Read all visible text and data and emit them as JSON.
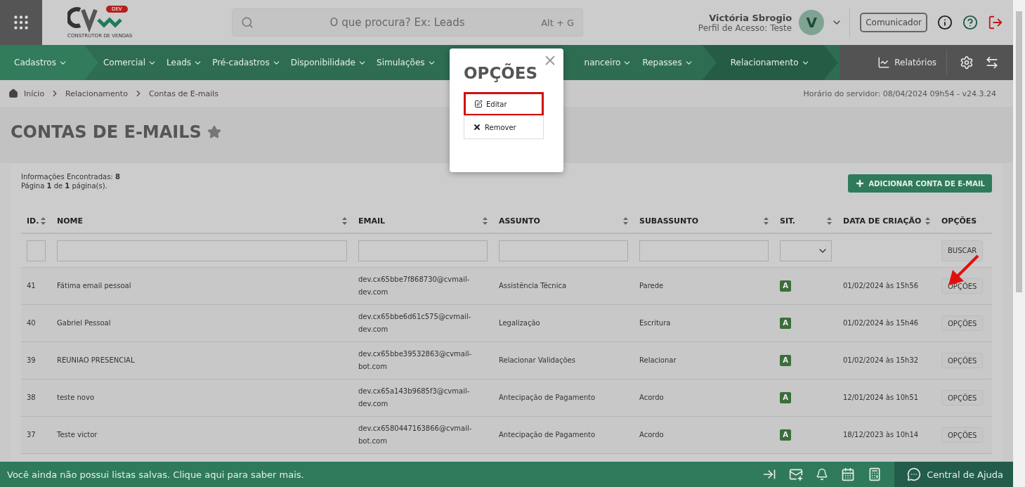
{
  "header": {
    "search": {
      "placeholder": "O que procura? Ex: Leads",
      "shortcut": "Alt + G"
    },
    "logo": {
      "badge": "DEV",
      "tagline": "CONSTRUTOR DE VENDAS"
    },
    "user": {
      "name": "Victória Sbrogio",
      "profile": "Perfil de Acesso: Teste",
      "initial": "V"
    },
    "communicator_button": "Comunicador"
  },
  "nav": {
    "items": [
      {
        "label": "Cadastros",
        "kind": "start"
      },
      {
        "label": "Comercial",
        "kind": "normal"
      },
      {
        "label": "Leads",
        "kind": "normal"
      },
      {
        "label": "Pré-cadastros",
        "kind": "normal"
      },
      {
        "label": "Disponibilidade",
        "kind": "normal"
      },
      {
        "label": "Simulações",
        "kind": "normal"
      },
      {
        "label": "nanceiro",
        "kind": "cut"
      },
      {
        "label": "Repasses",
        "kind": "normal"
      },
      {
        "label": "Relacionamento",
        "kind": "current"
      }
    ],
    "reports": "Relatórios"
  },
  "breadcrumb": [
    "Início",
    "Relacionamento",
    "Contas de E-mails"
  ],
  "server_time": "Horário do servidor: 08/04/2024 09h54 - v24.3.24",
  "page_title": "CONTAS DE E-MAILS",
  "summary": [
    "Informações Encontradas: **8**",
    "Página **1** de **1** página(s)."
  ],
  "add_button": "ADICIONAR CONTA DE E-MAIL",
  "table": {
    "columns": [
      {
        "label": "ID.",
        "sortable": true,
        "kind": "text"
      },
      {
        "label": "NOME",
        "sortable": true,
        "kind": "text"
      },
      {
        "label": "EMAIL",
        "sortable": true,
        "kind": "text"
      },
      {
        "label": "ASSUNTO",
        "sortable": true,
        "kind": "text"
      },
      {
        "label": "SUBASSUNTO",
        "sortable": true,
        "kind": "text"
      },
      {
        "label": "SIT.",
        "sortable": true,
        "kind": "select"
      },
      {
        "label": "DATA DE CRIAÇÃO",
        "sortable": true,
        "kind": "none"
      },
      {
        "label": "OPÇÕES",
        "sortable": false,
        "kind": "button"
      }
    ],
    "search_button": "BUSCAR",
    "rows": [
      {
        "id": "41",
        "name": "Fátima email pessoal",
        "email": "dev.cx65bbe7f868730@cvmail-dev.com",
        "subject": "Assistência Técnica",
        "subsubject": "Parede",
        "status": "A",
        "created": "01/02/2024 às 15h56",
        "options": "OPÇÕES"
      },
      {
        "id": "40",
        "name": "Gabriel Pessoal",
        "email": "dev.cx65bbe6d61c575@cvmail-dev.com",
        "subject": "Legalização",
        "subsubject": "Escritura",
        "status": "A",
        "created": "01/02/2024 às 15h46",
        "options": "OPÇÕES"
      },
      {
        "id": "39",
        "name": "REUNIAO PRESENCIAL",
        "email": "dev.cx65bbe39532863@cvmail-bot.com",
        "subject": "Relacionar Validações",
        "subsubject": "Relacionar",
        "status": "A",
        "created": "01/02/2024 às 15h32",
        "options": "OPÇÕES"
      },
      {
        "id": "38",
        "name": "teste novo",
        "email": "dev.cx65a143b9685f3@cvmail-dev.com",
        "subject": "Antecipação de Pagamento",
        "subsubject": "Acordo",
        "status": "A",
        "created": "12/01/2024 às 10h51",
        "options": "OPÇÕES"
      },
      {
        "id": "37",
        "name": "Teste victor",
        "email": "dev.cx6580447163866@cvmail-bot.com",
        "subject": "Antecipação de Pagamento",
        "subsubject": "Acordo",
        "status": "A",
        "created": "18/12/2023 às 10h14",
        "options": "OPÇÕES"
      }
    ]
  },
  "modal": {
    "title": "OPÇÕES",
    "items": [
      {
        "label": "Editar",
        "kind": "edit",
        "highlighted": true
      },
      {
        "label": "Remover",
        "kind": "remove",
        "highlighted": false
      }
    ]
  },
  "footer": {
    "message": "Você ainda não possui listas salvas. Clique aqui para saber mais.",
    "help": "Central de Ajuda"
  }
}
